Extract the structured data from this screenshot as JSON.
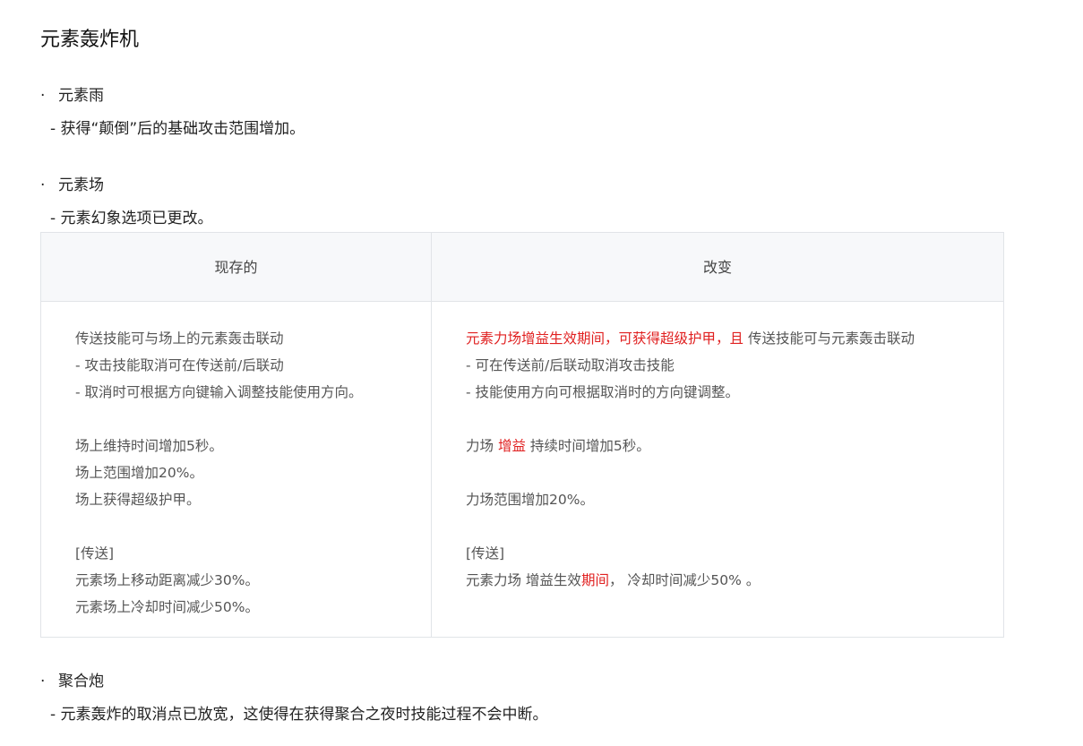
{
  "title": "元素轰炸机",
  "sections": [
    {
      "bullet": "·",
      "heading": "元素雨",
      "detail": "- 获得“颠倒”后的基础攻击范围增加。"
    },
    {
      "bullet": "·",
      "heading": "元素场",
      "detail": "- 元素幻象选项已更改。"
    },
    {
      "bullet": "·",
      "heading": "聚合炮",
      "detail": "- 元素轰炸的取消点已放宽，这使得在获得聚合之夜时技能过程不会中断。"
    }
  ],
  "table": {
    "headers": {
      "current": "现存的",
      "changed": "改变"
    },
    "current": {
      "l1": "传送技能可与场上的元素轰击联动",
      "l2": "- 攻击技能取消可在传送前/后联动",
      "l3": "- 取消时可根据方向键输入调整技能使用方向。",
      "l4": "场上维持时间增加5秒。",
      "l5": "场上范围增加20%。",
      "l6": "场上获得超级护甲。",
      "l7": "[传送]",
      "l8": "元素场上移动距离减少30%。",
      "l9": "元素场上冷却时间减少50%。"
    },
    "changed": {
      "l1_red": "元素力场增益生效期间，可获得超级护甲，且",
      "l1_rest": " 传送技能可与元素轰击联动",
      "l2": "- 可在传送前/后联动取消攻击技能",
      "l3": "- 技能使用方向可根据取消时的方向键调整。",
      "l4_a": "力场 ",
      "l4_red": "增益",
      "l4_b": " 持续时间增加5秒。",
      "l5": "力场范围增加20%。",
      "l6": "[传送]",
      "l7_a": "元素力场 增益生效",
      "l7_red": "期间",
      "l7_b": "， 冷却时间减少50% 。"
    }
  },
  "colors": {
    "highlight": "#e02020",
    "table_header_bg": "#f7f8fa",
    "border": "#e1e4e8"
  }
}
